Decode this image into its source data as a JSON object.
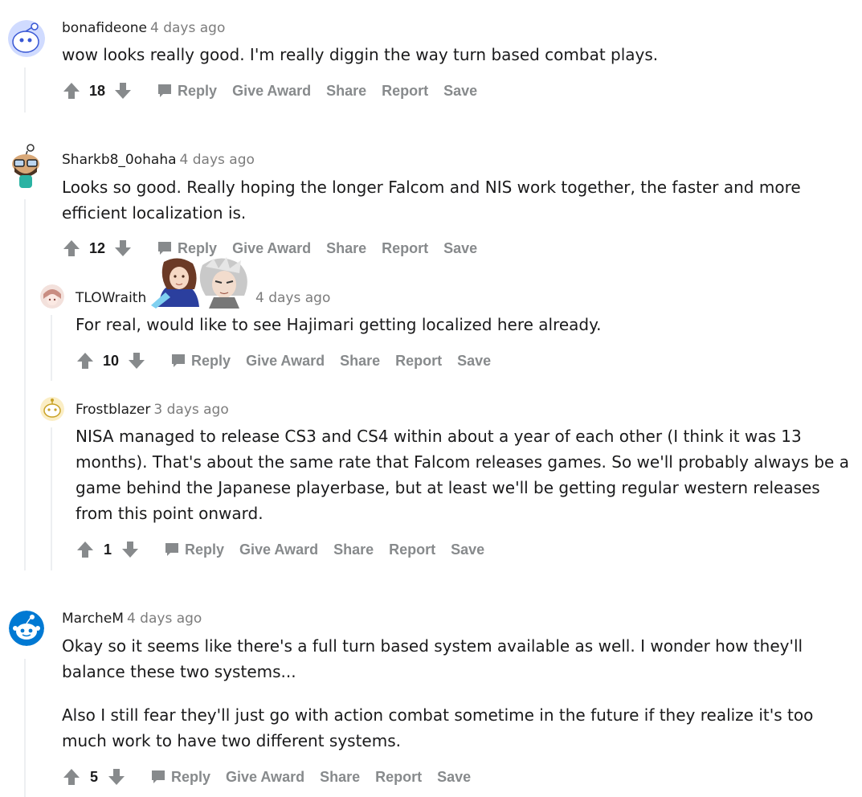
{
  "actions": {
    "reply": "Reply",
    "give_award": "Give Award",
    "share": "Share",
    "report": "Report",
    "save": "Save"
  },
  "comments": [
    {
      "author": "bonafideone",
      "time": "4 days ago",
      "body": [
        "wow looks really good. I'm really diggin the way turn based combat plays."
      ],
      "score": "18"
    },
    {
      "author": "Sharkb8_0ohaha",
      "time": "4 days ago",
      "body": [
        "Looks so good. Really hoping the longer Falcom and NIS work together, the faster and more efficient localization is."
      ],
      "score": "12"
    },
    {
      "author": "TLOWraith",
      "time": "4 days ago",
      "body": [
        "For real, would like to see Hajimari getting localized here already."
      ],
      "score": "10"
    },
    {
      "author": "Frostblazer",
      "time": "3 days ago",
      "body": [
        "NISA managed to release CS3 and CS4 within about a year of each other (I think it was 13 months). That's about the same rate that Falcom releases games. So we'll probably always be a game behind the Japanese playerbase, but at least we'll be getting regular western releases from this point onward."
      ],
      "score": "1"
    },
    {
      "author": "MarcheM",
      "time": "4 days ago",
      "body": [
        "Okay so it seems like there's a full turn based system available as well. I wonder how they'll balance these two systems...",
        "Also I still fear they'll just go with action combat sometime in the future if they realize it's too much work to have two different systems."
      ],
      "score": "5"
    }
  ],
  "colors": {
    "action_gray": "#878a8c",
    "thread_line": "#edeff1",
    "timestamp": "#7c7c7c"
  }
}
